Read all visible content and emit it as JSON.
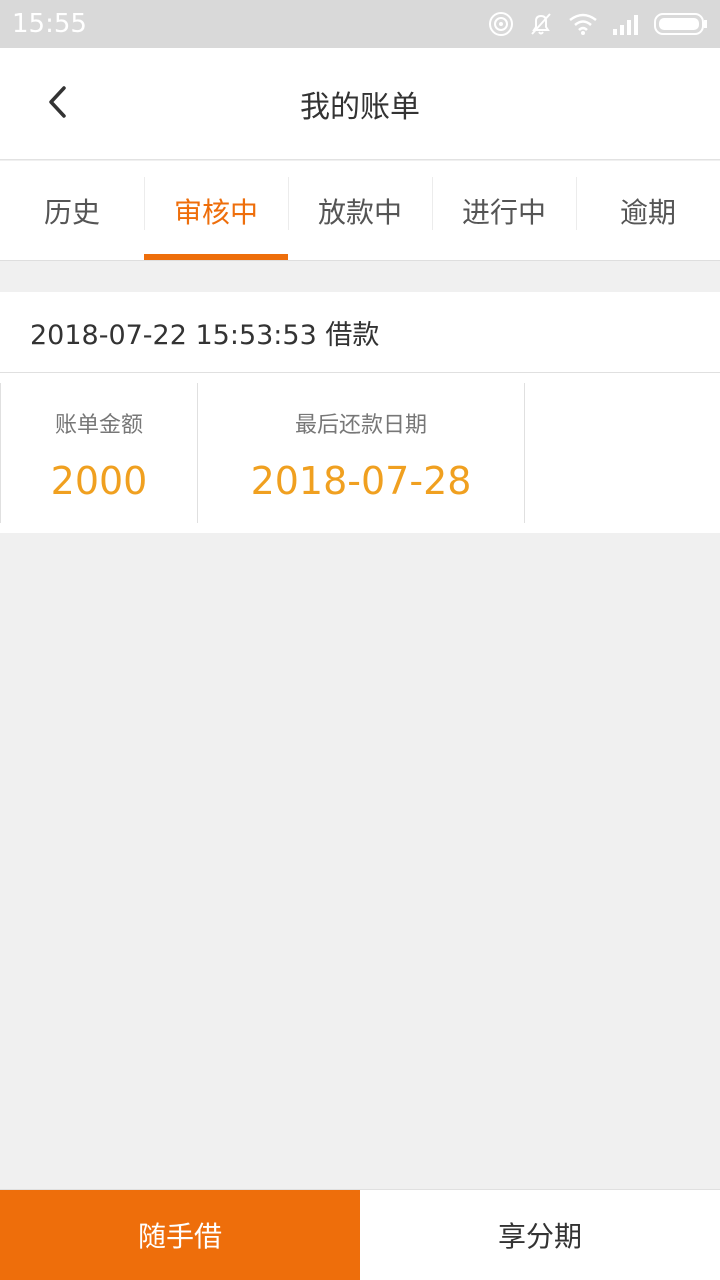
{
  "status_bar": {
    "time": "15:55",
    "icons": [
      "hotspot-icon",
      "mute-icon",
      "wifi-icon",
      "signal-icon",
      "battery-icon"
    ]
  },
  "header": {
    "title": "我的账单",
    "back_icon": "chevron-left-icon"
  },
  "tabs": [
    {
      "label": "历史",
      "active": false
    },
    {
      "label": "审核中",
      "active": true
    },
    {
      "label": "放款中",
      "active": false
    },
    {
      "label": "进行中",
      "active": false
    },
    {
      "label": "逾期",
      "active": false
    }
  ],
  "bill": {
    "title": "2018-07-22 15:53:53 借款",
    "amount_label": "账单金额",
    "amount_value": "2000",
    "due_label": "最后还款日期",
    "due_value": "2018-07-28"
  },
  "bottom_bar": {
    "borrow_label": "随手借",
    "installment_label": "享分期"
  },
  "colors": {
    "accent": "#ee6e0b",
    "value": "#f0a020",
    "background": "#f0f0f0"
  }
}
